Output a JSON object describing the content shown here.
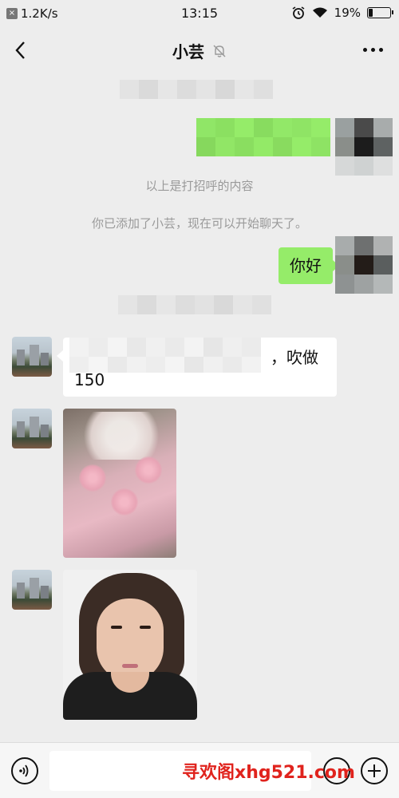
{
  "status_bar": {
    "network_speed": "1.2K/s",
    "time": "13:15",
    "battery_percent": "19%",
    "battery_level": 0.19,
    "icons": [
      "mute-icon",
      "alarm-icon",
      "wifi-icon",
      "battery-icon"
    ]
  },
  "nav": {
    "title": "小芸",
    "back_icon": "chevron-left-icon",
    "mute_icon": "bell-off-icon",
    "more_icon": "more-dots-icon"
  },
  "messages": {
    "system_greeting": "以上是打招呼的内容",
    "system_added": "你已添加了小芸，现在可以开始聊天了。",
    "my_hello": "你好",
    "their_text_visible": "，吹做",
    "their_text_line2": "150"
  },
  "bottom_bar": {
    "voice_icon": "voice-icon",
    "emoji_icon": "emoji-icon",
    "plus_icon": "plus-icon"
  },
  "watermark": "寻欢阁xhg521.com",
  "colors": {
    "my_bubble": "#95ec69",
    "their_bubble": "#ffffff",
    "background": "#ededed",
    "watermark": "#e0231d"
  }
}
